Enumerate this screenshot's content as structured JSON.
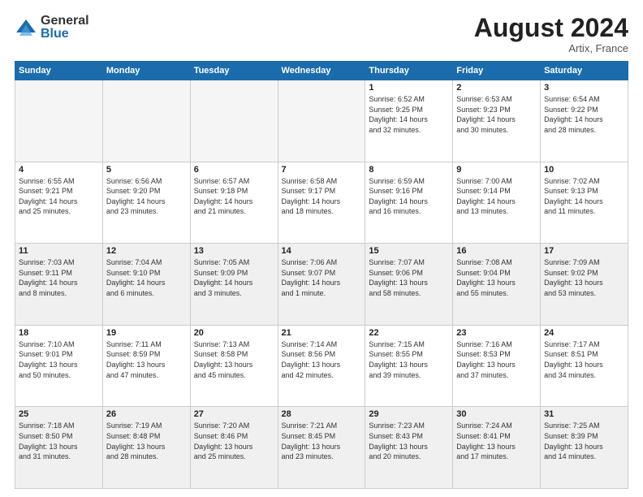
{
  "logo": {
    "general": "General",
    "blue": "Blue"
  },
  "title": "August 2024",
  "location": "Artix, France",
  "weekdays": [
    "Sunday",
    "Monday",
    "Tuesday",
    "Wednesday",
    "Thursday",
    "Friday",
    "Saturday"
  ],
  "weeks": [
    [
      {
        "day": "",
        "info": "",
        "empty": true
      },
      {
        "day": "",
        "info": "",
        "empty": true
      },
      {
        "day": "",
        "info": "",
        "empty": true
      },
      {
        "day": "",
        "info": "",
        "empty": true
      },
      {
        "day": "1",
        "info": "Sunrise: 6:52 AM\nSunset: 9:25 PM\nDaylight: 14 hours\nand 32 minutes."
      },
      {
        "day": "2",
        "info": "Sunrise: 6:53 AM\nSunset: 9:23 PM\nDaylight: 14 hours\nand 30 minutes."
      },
      {
        "day": "3",
        "info": "Sunrise: 6:54 AM\nSunset: 9:22 PM\nDaylight: 14 hours\nand 28 minutes."
      }
    ],
    [
      {
        "day": "4",
        "info": "Sunrise: 6:55 AM\nSunset: 9:21 PM\nDaylight: 14 hours\nand 25 minutes."
      },
      {
        "day": "5",
        "info": "Sunrise: 6:56 AM\nSunset: 9:20 PM\nDaylight: 14 hours\nand 23 minutes."
      },
      {
        "day": "6",
        "info": "Sunrise: 6:57 AM\nSunset: 9:18 PM\nDaylight: 14 hours\nand 21 minutes."
      },
      {
        "day": "7",
        "info": "Sunrise: 6:58 AM\nSunset: 9:17 PM\nDaylight: 14 hours\nand 18 minutes."
      },
      {
        "day": "8",
        "info": "Sunrise: 6:59 AM\nSunset: 9:16 PM\nDaylight: 14 hours\nand 16 minutes."
      },
      {
        "day": "9",
        "info": "Sunrise: 7:00 AM\nSunset: 9:14 PM\nDaylight: 14 hours\nand 13 minutes."
      },
      {
        "day": "10",
        "info": "Sunrise: 7:02 AM\nSunset: 9:13 PM\nDaylight: 14 hours\nand 11 minutes."
      }
    ],
    [
      {
        "day": "11",
        "info": "Sunrise: 7:03 AM\nSunset: 9:11 PM\nDaylight: 14 hours\nand 8 minutes.",
        "shaded": true
      },
      {
        "day": "12",
        "info": "Sunrise: 7:04 AM\nSunset: 9:10 PM\nDaylight: 14 hours\nand 6 minutes.",
        "shaded": true
      },
      {
        "day": "13",
        "info": "Sunrise: 7:05 AM\nSunset: 9:09 PM\nDaylight: 14 hours\nand 3 minutes.",
        "shaded": true
      },
      {
        "day": "14",
        "info": "Sunrise: 7:06 AM\nSunset: 9:07 PM\nDaylight: 14 hours\nand 1 minute.",
        "shaded": true
      },
      {
        "day": "15",
        "info": "Sunrise: 7:07 AM\nSunset: 9:06 PM\nDaylight: 13 hours\nand 58 minutes.",
        "shaded": true
      },
      {
        "day": "16",
        "info": "Sunrise: 7:08 AM\nSunset: 9:04 PM\nDaylight: 13 hours\nand 55 minutes.",
        "shaded": true
      },
      {
        "day": "17",
        "info": "Sunrise: 7:09 AM\nSunset: 9:02 PM\nDaylight: 13 hours\nand 53 minutes.",
        "shaded": true
      }
    ],
    [
      {
        "day": "18",
        "info": "Sunrise: 7:10 AM\nSunset: 9:01 PM\nDaylight: 13 hours\nand 50 minutes."
      },
      {
        "day": "19",
        "info": "Sunrise: 7:11 AM\nSunset: 8:59 PM\nDaylight: 13 hours\nand 47 minutes."
      },
      {
        "day": "20",
        "info": "Sunrise: 7:13 AM\nSunset: 8:58 PM\nDaylight: 13 hours\nand 45 minutes."
      },
      {
        "day": "21",
        "info": "Sunrise: 7:14 AM\nSunset: 8:56 PM\nDaylight: 13 hours\nand 42 minutes."
      },
      {
        "day": "22",
        "info": "Sunrise: 7:15 AM\nSunset: 8:55 PM\nDaylight: 13 hours\nand 39 minutes."
      },
      {
        "day": "23",
        "info": "Sunrise: 7:16 AM\nSunset: 8:53 PM\nDaylight: 13 hours\nand 37 minutes."
      },
      {
        "day": "24",
        "info": "Sunrise: 7:17 AM\nSunset: 8:51 PM\nDaylight: 13 hours\nand 34 minutes."
      }
    ],
    [
      {
        "day": "25",
        "info": "Sunrise: 7:18 AM\nSunset: 8:50 PM\nDaylight: 13 hours\nand 31 minutes.",
        "shaded": true
      },
      {
        "day": "26",
        "info": "Sunrise: 7:19 AM\nSunset: 8:48 PM\nDaylight: 13 hours\nand 28 minutes.",
        "shaded": true
      },
      {
        "day": "27",
        "info": "Sunrise: 7:20 AM\nSunset: 8:46 PM\nDaylight: 13 hours\nand 25 minutes.",
        "shaded": true
      },
      {
        "day": "28",
        "info": "Sunrise: 7:21 AM\nSunset: 8:45 PM\nDaylight: 13 hours\nand 23 minutes.",
        "shaded": true
      },
      {
        "day": "29",
        "info": "Sunrise: 7:23 AM\nSunset: 8:43 PM\nDaylight: 13 hours\nand 20 minutes.",
        "shaded": true
      },
      {
        "day": "30",
        "info": "Sunrise: 7:24 AM\nSunset: 8:41 PM\nDaylight: 13 hours\nand 17 minutes.",
        "shaded": true
      },
      {
        "day": "31",
        "info": "Sunrise: 7:25 AM\nSunset: 8:39 PM\nDaylight: 13 hours\nand 14 minutes.",
        "shaded": true
      }
    ]
  ]
}
